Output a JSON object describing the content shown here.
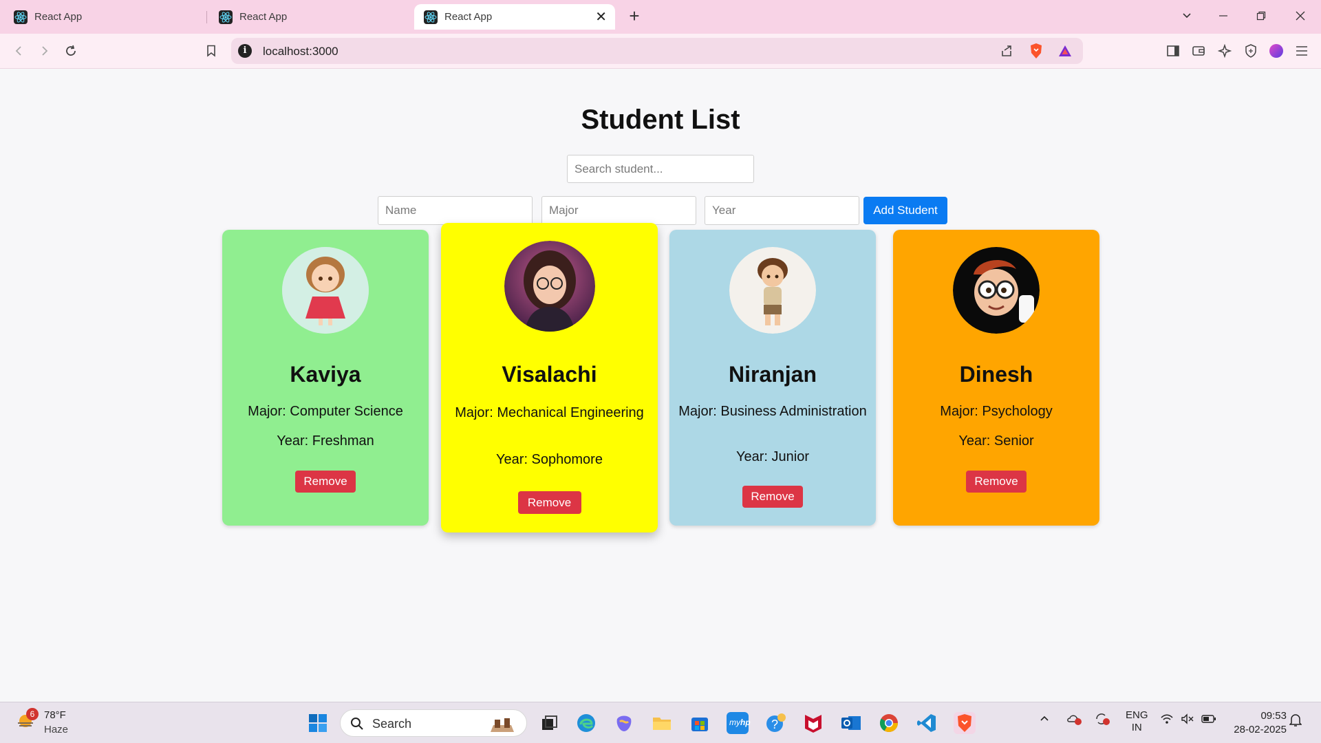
{
  "browser": {
    "tabs": [
      {
        "title": "React App"
      },
      {
        "title": "React App"
      },
      {
        "title": "React App",
        "close": "✕"
      }
    ],
    "new_tab": "+",
    "url": "localhost:3000"
  },
  "app": {
    "title": "Student List",
    "search": {
      "placeholder": "Search student..."
    },
    "form": {
      "name_placeholder": "Name",
      "major_placeholder": "Major",
      "year_placeholder": "Year",
      "add_label": "Add Student"
    },
    "students": [
      {
        "name": "Kaviya",
        "major": "Major: Computer Science",
        "year": "Year: Freshman",
        "remove": "Remove",
        "color": "#90ee90"
      },
      {
        "name": "Visalachi",
        "major": "Major: Mechanical Engineering",
        "year": "Year: Sophomore",
        "remove": "Remove",
        "color": "#ffff00"
      },
      {
        "name": "Niranjan",
        "major": "Major: Business Administration",
        "year": "Year: Junior",
        "remove": "Remove",
        "color": "#add8e6"
      },
      {
        "name": "Dinesh",
        "major": "Major: Psychology",
        "year": "Year: Senior",
        "remove": "Remove",
        "color": "#ffa500"
      }
    ]
  },
  "taskbar": {
    "weather": {
      "temp": "78°F",
      "desc": "Haze",
      "badge": "6"
    },
    "search_label": "Search",
    "lang_line1": "ENG",
    "lang_line2": "IN",
    "time": "09:53",
    "date": "28-02-2025"
  }
}
